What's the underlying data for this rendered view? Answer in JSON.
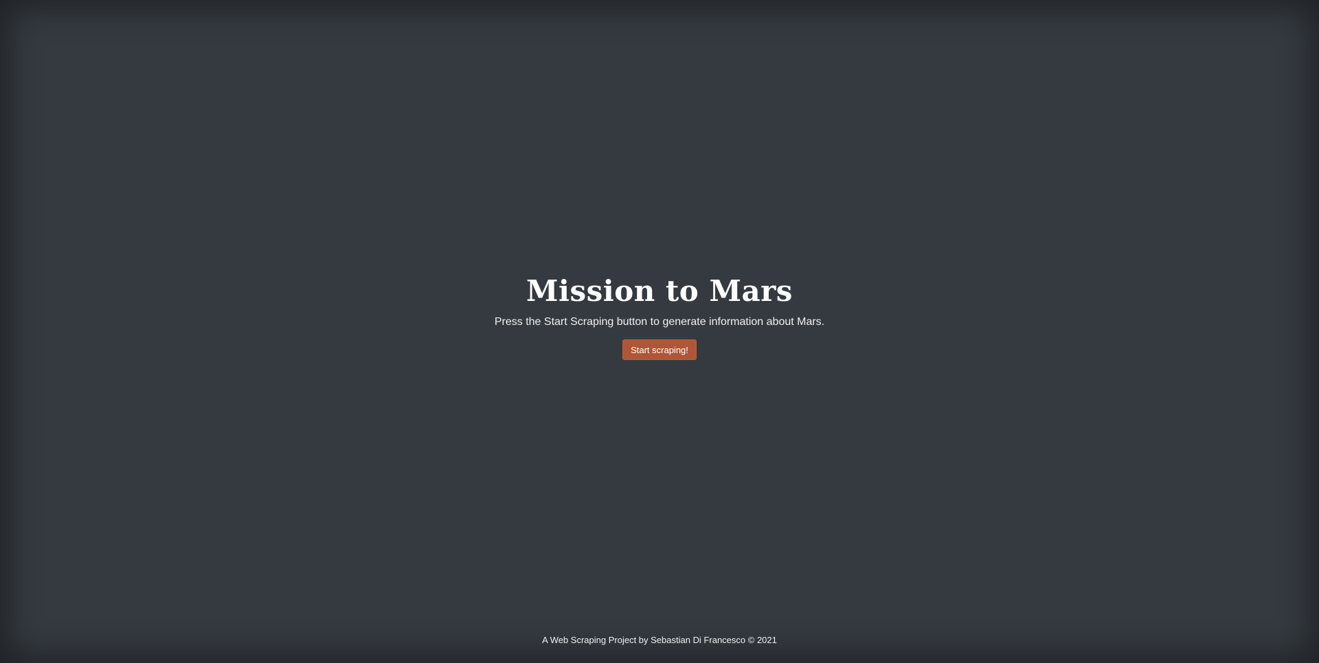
{
  "hero": {
    "title": "Mission to Mars",
    "subtitle": "Press the Start Scraping button to generate information about Mars.",
    "button_label": "Start scraping!"
  },
  "footer": {
    "text": "A Web Scraping Project by Sebastian Di Francesco © 2021"
  },
  "colors": {
    "background": "#343a40",
    "button": "#b05535",
    "text": "#ffffff"
  }
}
